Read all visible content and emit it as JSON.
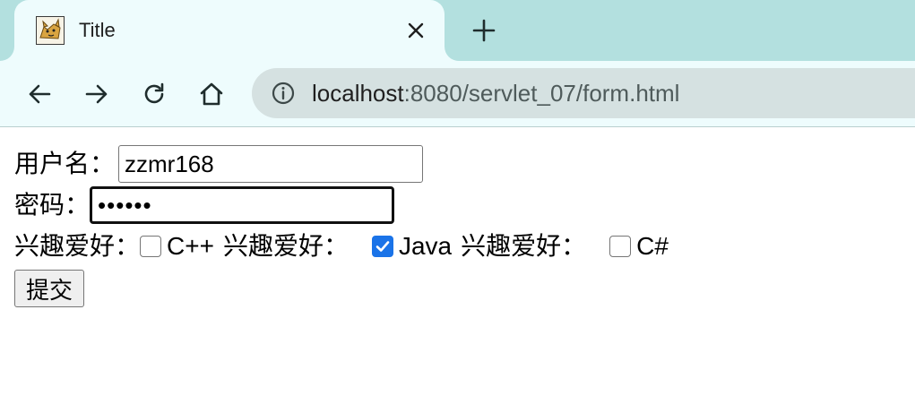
{
  "browser": {
    "tab": {
      "title": "Title",
      "favicon": "tomcat-favicon-icon",
      "close_icon": "close-icon"
    },
    "new_tab_icon": "plus-icon",
    "toolbar": {
      "back_icon": "arrow-left-icon",
      "forward_icon": "arrow-right-icon",
      "reload_icon": "reload-icon",
      "home_icon": "home-icon",
      "info_icon": "info-icon",
      "url_host": "localhost",
      "url_rest": ":8080/servlet_07/form.html"
    },
    "colors": {
      "tabstrip": "#b3e0df",
      "active_tab": "#eefcfd",
      "omnibox": "#d5e1e1",
      "checkbox_accent": "#1a73e8"
    }
  },
  "form": {
    "username_label": "用户名：",
    "username_value": "zzmr168",
    "password_label": "密码：",
    "password_value": "••••••",
    "hobbies": [
      {
        "label": "兴趣爱好：",
        "option": "C++",
        "checked": false
      },
      {
        "label": "兴趣爱好：",
        "option": "Java",
        "checked": true
      },
      {
        "label": "兴趣爱好：",
        "option": "C#",
        "checked": false
      }
    ],
    "submit_label": "提交"
  }
}
